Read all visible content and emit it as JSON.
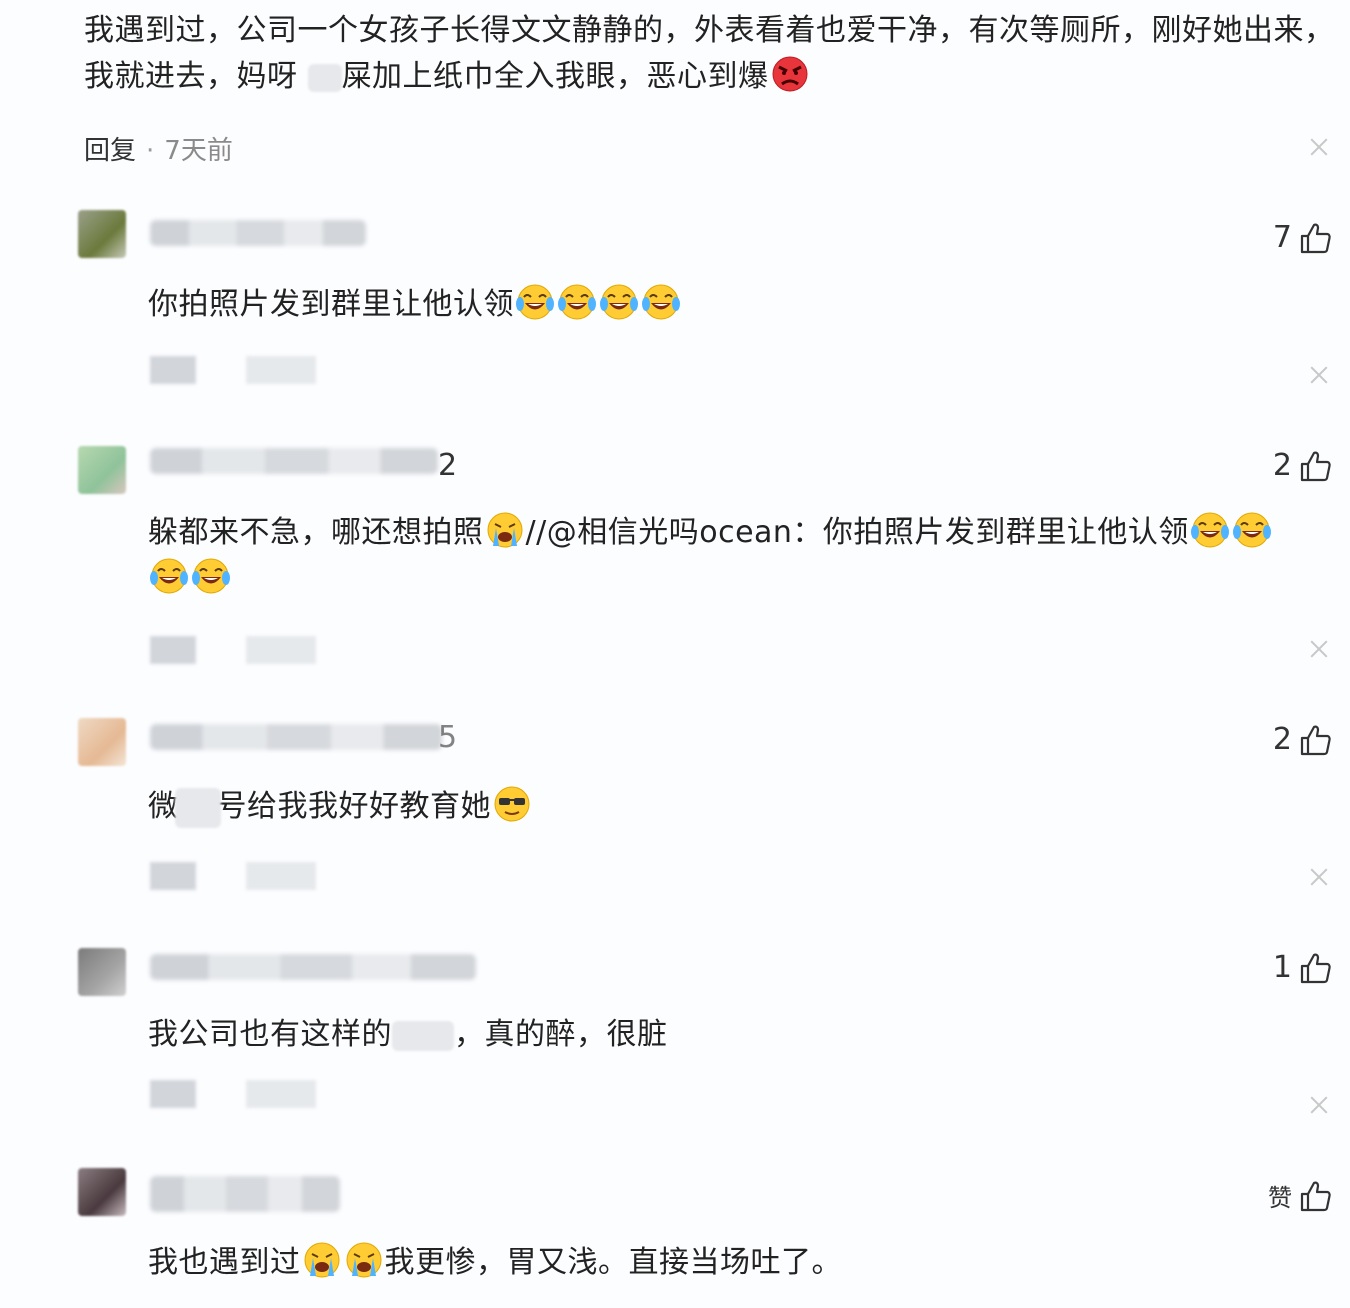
{
  "main_comment": {
    "text_part1": "我遇到过，公司一个女孩子长得文文静静的，外表看着也爱干净，有次等厕所，刚好她出来，我就进去，妈呀 ",
    "text_part2": "屎加上纸巾全入我眼，恶心到爆",
    "emoji": "angry-face",
    "reply_label": "回复",
    "separator": "·",
    "time": "7天前"
  },
  "replies": [
    {
      "name_suffix": "",
      "likes": "7",
      "text": "你拍照片发到群里让他认领",
      "emojis": [
        "laugh-cry",
        "laugh-cry",
        "laugh-cry",
        "laugh-cry"
      ]
    },
    {
      "name_suffix": "2",
      "likes": "2",
      "text": "躲都来不急，哪还想拍照",
      "emoji_after_text": "crying",
      "quote": "//@相信光吗ocean：你拍照片发到群里让他认领",
      "emojis": [
        "laugh-cry",
        "laugh-cry",
        "laugh-cry",
        "laugh-cry"
      ]
    },
    {
      "name_suffix": "5",
      "likes": "2",
      "text_before": "微",
      "text_after": "号给我我好好教育她",
      "emojis": [
        "cool-face"
      ]
    },
    {
      "name_suffix": "",
      "likes": "1",
      "text_before": "我公司也有这样的",
      "text_after": "，真的醉，很脏"
    },
    {
      "name_suffix": "",
      "likes": "赞",
      "text_before": "我也遇到过",
      "text_after": "我更惨，胃又浅。直接当场吐了。",
      "emojis": [
        "crying",
        "crying"
      ]
    }
  ],
  "colors": {
    "background": "#fcfdff",
    "text": "#222222",
    "muted": "#8a8a8a",
    "close": "#c8c8c8"
  }
}
